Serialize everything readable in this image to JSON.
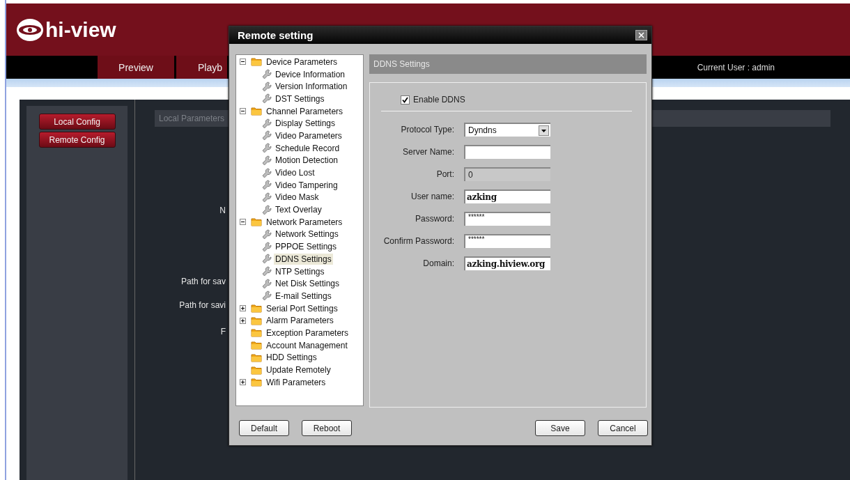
{
  "header": {
    "logo_text": "hi-view"
  },
  "nav": {
    "tabs": [
      {
        "label": "Preview"
      },
      {
        "label": "Playb"
      }
    ],
    "current_user": "Current User : admin"
  },
  "sidebar": {
    "buttons": [
      "Local Config",
      "Remote Config"
    ]
  },
  "content": {
    "section_title": "Local Parameters",
    "labels": [
      "N",
      "Path for sav",
      "Path for savi",
      "F"
    ]
  },
  "dialog": {
    "title": "Remote setting",
    "tree": [
      {
        "label": "Device Parameters",
        "expanded": true,
        "children": [
          {
            "label": "Device Information",
            "selected": false
          },
          {
            "label": "Version Information",
            "selected": false
          },
          {
            "label": "DST Settings",
            "selected": false
          }
        ]
      },
      {
        "label": "Channel Parameters",
        "expanded": true,
        "children": [
          {
            "label": "Display Settings",
            "selected": false
          },
          {
            "label": "Video Parameters",
            "selected": false
          },
          {
            "label": "Schedule Record",
            "selected": false
          },
          {
            "label": "Motion Detection",
            "selected": false
          },
          {
            "label": "Video Lost",
            "selected": false
          },
          {
            "label": "Video Tampering",
            "selected": false
          },
          {
            "label": "Video Mask",
            "selected": false
          },
          {
            "label": "Text Overlay",
            "selected": false
          }
        ]
      },
      {
        "label": "Network Parameters",
        "expanded": true,
        "children": [
          {
            "label": "Network Settings",
            "selected": false
          },
          {
            "label": "PPPOE Settings",
            "selected": false
          },
          {
            "label": "DDNS Settings",
            "selected": true
          },
          {
            "label": "NTP Settings",
            "selected": false
          },
          {
            "label": "Net Disk Settings",
            "selected": false
          },
          {
            "label": "E-mail Settings",
            "selected": false
          }
        ]
      },
      {
        "label": "Serial Port Settings",
        "expanded": false
      },
      {
        "label": "Alarm Parameters",
        "expanded": false
      },
      {
        "label": "Exception Parameters"
      },
      {
        "label": "Account Management"
      },
      {
        "label": "HDD Settings"
      },
      {
        "label": "Update Remotely"
      },
      {
        "label": "Wifi Parameters",
        "expanded": false
      }
    ],
    "panel_title": "DDNS Settings",
    "enable": {
      "label": "Enable DDNS",
      "checked": true
    },
    "fields": [
      {
        "label": "Protocol Type:",
        "kind": "select",
        "value": "Dyndns"
      },
      {
        "label": "Server Name:",
        "kind": "text",
        "disabled": false
      },
      {
        "label": "Port:",
        "kind": "text",
        "value": "0",
        "disabled": true
      },
      {
        "label": "User name:",
        "kind": "text",
        "value": "azking",
        "disabled": false
      },
      {
        "label": "Password:",
        "kind": "password",
        "value": "******"
      },
      {
        "label": "Confirm Password:",
        "kind": "password",
        "value": "******"
      },
      {
        "label": "Domain:",
        "kind": "text",
        "value": "azking.hiview.org",
        "disabled": false
      }
    ],
    "left_buttons": [
      "Default",
      "Reboot"
    ],
    "right_buttons": [
      "Save",
      "Cancel"
    ]
  }
}
